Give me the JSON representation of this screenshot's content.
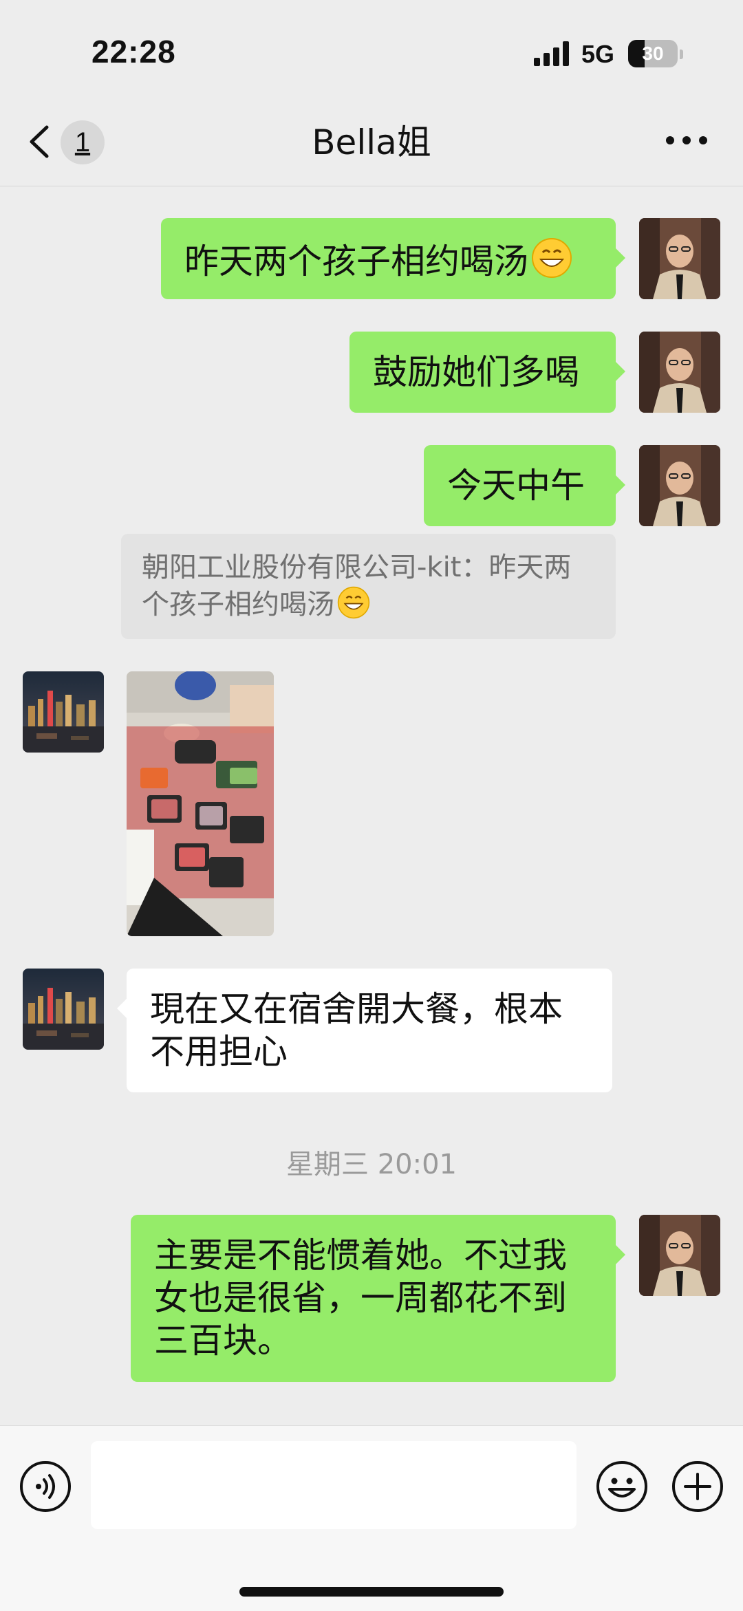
{
  "status_bar": {
    "time": "22:28",
    "network": "5G",
    "battery": "30"
  },
  "header": {
    "unread_count": "1",
    "title": "Bella姐"
  },
  "messages": [
    {
      "sender": "me",
      "text": "昨天两个孩子相约喝汤",
      "emoji": "grinning-face-emoji"
    },
    {
      "sender": "me",
      "text": "鼓励她们多喝"
    },
    {
      "sender": "me",
      "text": "今天中午"
    },
    {
      "type": "quote",
      "text": "朝阳工业股份有限公司-kit：昨天两个孩子相约喝汤",
      "emoji": "grinning-face-emoji"
    },
    {
      "sender": "other",
      "type": "image",
      "icon": "photo-hotpot-food-on-floor"
    },
    {
      "sender": "other",
      "text": "現在又在宿舍開大餐，根本不用担心"
    },
    {
      "type": "timestamp",
      "text": "星期三 20:01"
    },
    {
      "sender": "me",
      "text": "主要是不能惯着她。不过我女也是很省，一周都花不到三百块。"
    }
  ],
  "composer": {
    "input_value": ""
  },
  "colors": {
    "background": "#EDEDED",
    "my_bubble": "#95EC69",
    "other_bubble": "#FFFFFF",
    "quote_bg": "#E3E3E3"
  }
}
